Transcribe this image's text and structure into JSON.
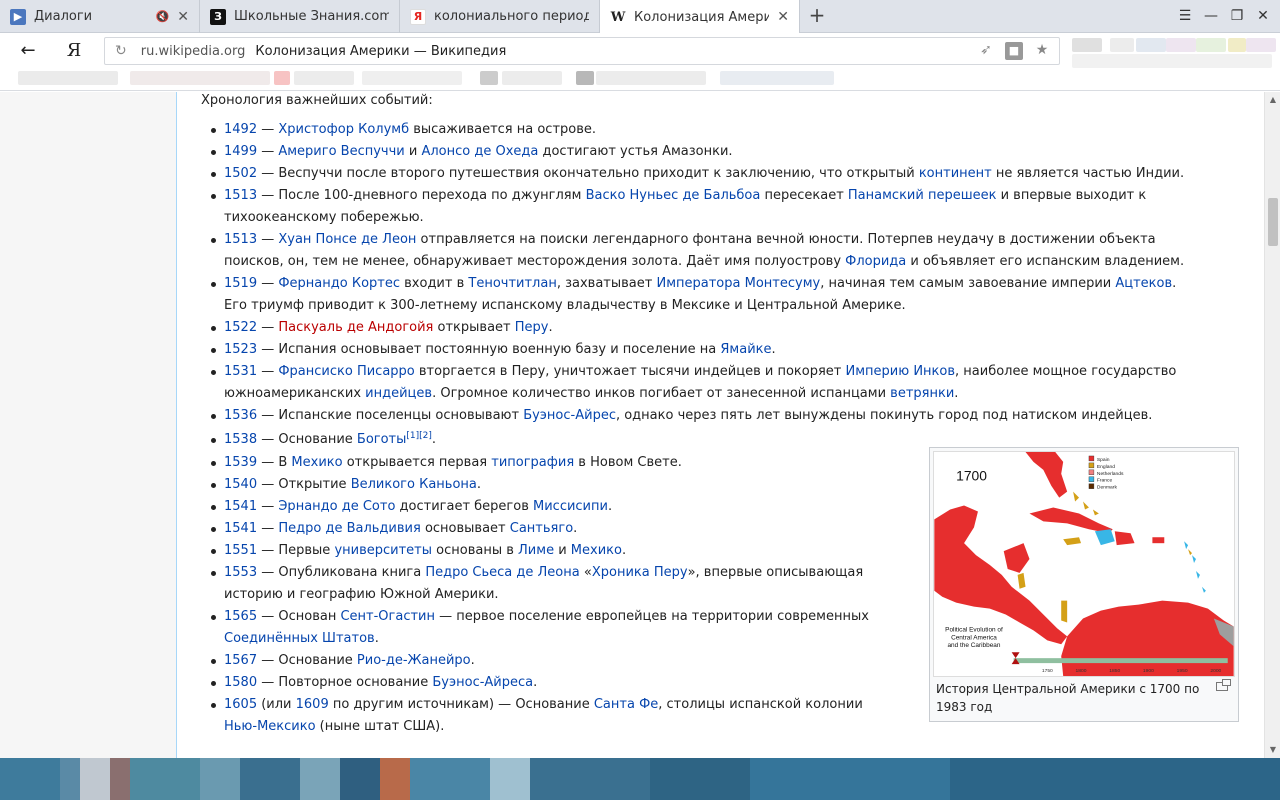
{
  "browser": {
    "tabs": [
      {
        "title": "Диалоги",
        "favicon": "video-icon",
        "mute": "🔇",
        "close": "✕"
      },
      {
        "title": "Школьные Знания.com - Ре",
        "favicon": "znanija-icon",
        "favicon_text": "З"
      },
      {
        "title": "колониального периода в с",
        "favicon": "yandex-icon",
        "favicon_text": "Я"
      },
      {
        "title": "Колонизация Америки –",
        "favicon": "wikipedia-icon",
        "favicon_text": "W",
        "active": true,
        "close": "✕"
      }
    ],
    "new_tab": "+",
    "window_controls": {
      "menu": "☰",
      "minimize": "—",
      "restore": "❐",
      "close": "✕"
    },
    "back": "←",
    "yandex_logo": "Я",
    "reload": "↻",
    "domain": "ru.wikipedia.org",
    "page_title": "Колонизация Америки — Википедия",
    "omnibox_icons": {
      "rocket": "➶",
      "lock": "🔒",
      "star": "★"
    }
  },
  "article": {
    "section_title": "Хронология важнейших событий:",
    "events": [
      {
        "parts": [
          {
            "t": "1492",
            "l": "link"
          },
          {
            "t": " — "
          },
          {
            "t": "Христофор Колумб",
            "l": "link"
          },
          {
            "t": " высаживается на острове."
          }
        ]
      },
      {
        "parts": [
          {
            "t": "1499",
            "l": "link"
          },
          {
            "t": " — "
          },
          {
            "t": "Америго Веспуччи",
            "l": "link"
          },
          {
            "t": " и "
          },
          {
            "t": "Алонсо де Охеда",
            "l": "link"
          },
          {
            "t": " достигают устья Амазонки."
          }
        ]
      },
      {
        "parts": [
          {
            "t": "1502",
            "l": "link"
          },
          {
            "t": " — Веспуччи после второго путешествия окончательно приходит к заключению, что открытый "
          },
          {
            "t": "континент",
            "l": "link"
          },
          {
            "t": " не является частью Индии."
          }
        ]
      },
      {
        "parts": [
          {
            "t": "1513",
            "l": "link"
          },
          {
            "t": " — После 100-дневного перехода по джунглям "
          },
          {
            "t": "Васко Нуньес де Бальбоа",
            "l": "link"
          },
          {
            "t": " пересекает "
          },
          {
            "t": "Панамский перешеек",
            "l": "link"
          },
          {
            "t": " и впервые выходит к тихоокеанскому побережью."
          }
        ]
      },
      {
        "parts": [
          {
            "t": "1513",
            "l": "link"
          },
          {
            "t": " — "
          },
          {
            "t": "Хуан Понсе де Леон",
            "l": "link"
          },
          {
            "t": " отправляется на поиски легендарного фонтана вечной юности. Потерпев неудачу в достижении объекта поисков, он, тем не менее, обнаруживает месторождения золота. Даёт имя полуострову "
          },
          {
            "t": "Флорида",
            "l": "link"
          },
          {
            "t": " и объявляет его испанским владением."
          }
        ]
      },
      {
        "parts": [
          {
            "t": "1519",
            "l": "link"
          },
          {
            "t": " — "
          },
          {
            "t": "Фернандо Кортес",
            "l": "link"
          },
          {
            "t": " входит в "
          },
          {
            "t": "Теночтитлан",
            "l": "link"
          },
          {
            "t": ", захватывает "
          },
          {
            "t": "Императора Монтесуму",
            "l": "link"
          },
          {
            "t": ", начиная тем самым завоевание империи "
          },
          {
            "t": "Ацтеков",
            "l": "link"
          },
          {
            "t": ". Его триумф приводит к 300-летнему испанскому владычеству в Мексике и Центральной Америке."
          }
        ]
      },
      {
        "parts": [
          {
            "t": "1522",
            "l": "link"
          },
          {
            "t": " — "
          },
          {
            "t": "Паскуаль де Андогойя",
            "l": "red"
          },
          {
            "t": " открывает "
          },
          {
            "t": "Перу",
            "l": "link"
          },
          {
            "t": "."
          }
        ]
      },
      {
        "parts": [
          {
            "t": "1523",
            "l": "link"
          },
          {
            "t": " — Испания основывает постоянную военную базу и поселение на "
          },
          {
            "t": "Ямайке",
            "l": "link"
          },
          {
            "t": "."
          }
        ]
      },
      {
        "parts": [
          {
            "t": "1531",
            "l": "link"
          },
          {
            "t": " — "
          },
          {
            "t": "Франсиско Писарро",
            "l": "link"
          },
          {
            "t": " вторгается в Перу, уничтожает тысячи индейцев и покоряет "
          },
          {
            "t": "Империю Инков",
            "l": "link"
          },
          {
            "t": ", наиболее мощное государство южноамериканских "
          },
          {
            "t": "индейцев",
            "l": "link"
          },
          {
            "t": ". Огромное количество инков погибает от занесенной испанцами "
          },
          {
            "t": "ветрянки",
            "l": "link"
          },
          {
            "t": "."
          }
        ]
      },
      {
        "parts": [
          {
            "t": "1536",
            "l": "link"
          },
          {
            "t": " — Испанские поселенцы основывают "
          },
          {
            "t": "Буэнос-Айрес",
            "l": "link"
          },
          {
            "t": ", однако через пять лет вынуждены покинуть город под натиском индейцев."
          }
        ]
      },
      {
        "parts": [
          {
            "t": "1538",
            "l": "link"
          },
          {
            "t": " — Основание "
          },
          {
            "t": "Боготы",
            "l": "link"
          },
          {
            "t": "[1]",
            "l": "sup"
          },
          {
            "t": "[2]",
            "l": "sup"
          },
          {
            "t": "."
          }
        ]
      },
      {
        "parts": [
          {
            "t": "1539",
            "l": "link"
          },
          {
            "t": " — В "
          },
          {
            "t": "Мехико",
            "l": "link"
          },
          {
            "t": " открывается первая "
          },
          {
            "t": "типография",
            "l": "link"
          },
          {
            "t": " в Новом Свете."
          }
        ]
      },
      {
        "parts": [
          {
            "t": "1540",
            "l": "link"
          },
          {
            "t": " — Открытие "
          },
          {
            "t": "Великого Каньона",
            "l": "link"
          },
          {
            "t": "."
          }
        ]
      },
      {
        "parts": [
          {
            "t": "1541",
            "l": "link"
          },
          {
            "t": " — "
          },
          {
            "t": "Эрнандо де Сото",
            "l": "link"
          },
          {
            "t": " достигает берегов "
          },
          {
            "t": "Миссисипи",
            "l": "link"
          },
          {
            "t": "."
          }
        ]
      },
      {
        "parts": [
          {
            "t": "1541",
            "l": "link"
          },
          {
            "t": " — "
          },
          {
            "t": "Педро де Вальдивия",
            "l": "link"
          },
          {
            "t": " основывает "
          },
          {
            "t": "Сантьяго",
            "l": "link"
          },
          {
            "t": "."
          }
        ]
      },
      {
        "parts": [
          {
            "t": "1551",
            "l": "link"
          },
          {
            "t": " — Первые "
          },
          {
            "t": "университеты",
            "l": "link"
          },
          {
            "t": " основаны в "
          },
          {
            "t": "Лиме",
            "l": "link"
          },
          {
            "t": " и "
          },
          {
            "t": "Мехико",
            "l": "link"
          },
          {
            "t": "."
          }
        ]
      },
      {
        "parts": [
          {
            "t": "1553",
            "l": "link"
          },
          {
            "t": " — Опубликована книга "
          },
          {
            "t": "Педро Сьеса де Леона",
            "l": "link"
          },
          {
            "t": " «"
          },
          {
            "t": "Хроника Перу",
            "l": "link"
          },
          {
            "t": "», впервые описывающая историю и географию Южной Америки."
          }
        ]
      },
      {
        "parts": [
          {
            "t": "1565",
            "l": "link"
          },
          {
            "t": " — Основан "
          },
          {
            "t": "Сент-Огастин",
            "l": "link"
          },
          {
            "t": " — первое поселение европейцев на территории современных "
          },
          {
            "t": "Соединённых Штатов",
            "l": "link"
          },
          {
            "t": "."
          }
        ]
      },
      {
        "parts": [
          {
            "t": "1567",
            "l": "link"
          },
          {
            "t": " — Основание "
          },
          {
            "t": "Рио-де-Жанейро",
            "l": "link"
          },
          {
            "t": "."
          }
        ]
      },
      {
        "parts": [
          {
            "t": "1580",
            "l": "link"
          },
          {
            "t": " — Повторное основание "
          },
          {
            "t": "Буэнос-Айреса",
            "l": "link"
          },
          {
            "t": "."
          }
        ]
      },
      {
        "parts": [
          {
            "t": "1605",
            "l": "link"
          },
          {
            "t": " (или "
          },
          {
            "t": "1609",
            "l": "link"
          },
          {
            "t": " по другим источникам) — Основание "
          },
          {
            "t": "Санта Фе",
            "l": "link"
          },
          {
            "t": ", столицы испанской колонии "
          },
          {
            "t": "Нью-Мексико",
            "l": "link"
          },
          {
            "t": " (ныне штат США)."
          }
        ]
      }
    ],
    "thumb": {
      "map_year": "1700",
      "map_legend": [
        "Spain",
        "England",
        "Netherlands",
        "France",
        "Denmark"
      ],
      "map_legend_colors": [
        "#e62e2e",
        "#d4a017",
        "#f08080",
        "#38b6e6",
        "#5a2a00"
      ],
      "map_title_lines": [
        "Political Evolution of",
        "Central America",
        "and the Caribbean"
      ],
      "timeline_ticks": [
        "1750",
        "1800",
        "1850",
        "1900",
        "1950",
        "2000"
      ],
      "caption": "История Центральной Америки с 1700 по 1983 год"
    }
  },
  "colors": {
    "link": "#0645ad",
    "redlink": "#ba0000",
    "tab_bg": "#dfe3ea"
  }
}
